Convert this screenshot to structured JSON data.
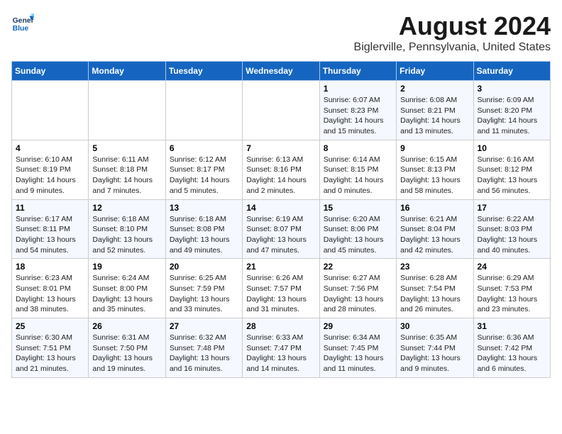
{
  "header": {
    "logo_line1": "General",
    "logo_line2": "Blue",
    "main_title": "August 2024",
    "subtitle": "Biglerville, Pennsylvania, United States"
  },
  "weekdays": [
    "Sunday",
    "Monday",
    "Tuesday",
    "Wednesday",
    "Thursday",
    "Friday",
    "Saturday"
  ],
  "weeks": [
    [
      {
        "day": "",
        "info": ""
      },
      {
        "day": "",
        "info": ""
      },
      {
        "day": "",
        "info": ""
      },
      {
        "day": "",
        "info": ""
      },
      {
        "day": "1",
        "info": "Sunrise: 6:07 AM\nSunset: 8:23 PM\nDaylight: 14 hours and 15 minutes."
      },
      {
        "day": "2",
        "info": "Sunrise: 6:08 AM\nSunset: 8:21 PM\nDaylight: 14 hours and 13 minutes."
      },
      {
        "day": "3",
        "info": "Sunrise: 6:09 AM\nSunset: 8:20 PM\nDaylight: 14 hours and 11 minutes."
      }
    ],
    [
      {
        "day": "4",
        "info": "Sunrise: 6:10 AM\nSunset: 8:19 PM\nDaylight: 14 hours and 9 minutes."
      },
      {
        "day": "5",
        "info": "Sunrise: 6:11 AM\nSunset: 8:18 PM\nDaylight: 14 hours and 7 minutes."
      },
      {
        "day": "6",
        "info": "Sunrise: 6:12 AM\nSunset: 8:17 PM\nDaylight: 14 hours and 5 minutes."
      },
      {
        "day": "7",
        "info": "Sunrise: 6:13 AM\nSunset: 8:16 PM\nDaylight: 14 hours and 2 minutes."
      },
      {
        "day": "8",
        "info": "Sunrise: 6:14 AM\nSunset: 8:15 PM\nDaylight: 14 hours and 0 minutes."
      },
      {
        "day": "9",
        "info": "Sunrise: 6:15 AM\nSunset: 8:13 PM\nDaylight: 13 hours and 58 minutes."
      },
      {
        "day": "10",
        "info": "Sunrise: 6:16 AM\nSunset: 8:12 PM\nDaylight: 13 hours and 56 minutes."
      }
    ],
    [
      {
        "day": "11",
        "info": "Sunrise: 6:17 AM\nSunset: 8:11 PM\nDaylight: 13 hours and 54 minutes."
      },
      {
        "day": "12",
        "info": "Sunrise: 6:18 AM\nSunset: 8:10 PM\nDaylight: 13 hours and 52 minutes."
      },
      {
        "day": "13",
        "info": "Sunrise: 6:18 AM\nSunset: 8:08 PM\nDaylight: 13 hours and 49 minutes."
      },
      {
        "day": "14",
        "info": "Sunrise: 6:19 AM\nSunset: 8:07 PM\nDaylight: 13 hours and 47 minutes."
      },
      {
        "day": "15",
        "info": "Sunrise: 6:20 AM\nSunset: 8:06 PM\nDaylight: 13 hours and 45 minutes."
      },
      {
        "day": "16",
        "info": "Sunrise: 6:21 AM\nSunset: 8:04 PM\nDaylight: 13 hours and 42 minutes."
      },
      {
        "day": "17",
        "info": "Sunrise: 6:22 AM\nSunset: 8:03 PM\nDaylight: 13 hours and 40 minutes."
      }
    ],
    [
      {
        "day": "18",
        "info": "Sunrise: 6:23 AM\nSunset: 8:01 PM\nDaylight: 13 hours and 38 minutes."
      },
      {
        "day": "19",
        "info": "Sunrise: 6:24 AM\nSunset: 8:00 PM\nDaylight: 13 hours and 35 minutes."
      },
      {
        "day": "20",
        "info": "Sunrise: 6:25 AM\nSunset: 7:59 PM\nDaylight: 13 hours and 33 minutes."
      },
      {
        "day": "21",
        "info": "Sunrise: 6:26 AM\nSunset: 7:57 PM\nDaylight: 13 hours and 31 minutes."
      },
      {
        "day": "22",
        "info": "Sunrise: 6:27 AM\nSunset: 7:56 PM\nDaylight: 13 hours and 28 minutes."
      },
      {
        "day": "23",
        "info": "Sunrise: 6:28 AM\nSunset: 7:54 PM\nDaylight: 13 hours and 26 minutes."
      },
      {
        "day": "24",
        "info": "Sunrise: 6:29 AM\nSunset: 7:53 PM\nDaylight: 13 hours and 23 minutes."
      }
    ],
    [
      {
        "day": "25",
        "info": "Sunrise: 6:30 AM\nSunset: 7:51 PM\nDaylight: 13 hours and 21 minutes."
      },
      {
        "day": "26",
        "info": "Sunrise: 6:31 AM\nSunset: 7:50 PM\nDaylight: 13 hours and 19 minutes."
      },
      {
        "day": "27",
        "info": "Sunrise: 6:32 AM\nSunset: 7:48 PM\nDaylight: 13 hours and 16 minutes."
      },
      {
        "day": "28",
        "info": "Sunrise: 6:33 AM\nSunset: 7:47 PM\nDaylight: 13 hours and 14 minutes."
      },
      {
        "day": "29",
        "info": "Sunrise: 6:34 AM\nSunset: 7:45 PM\nDaylight: 13 hours and 11 minutes."
      },
      {
        "day": "30",
        "info": "Sunrise: 6:35 AM\nSunset: 7:44 PM\nDaylight: 13 hours and 9 minutes."
      },
      {
        "day": "31",
        "info": "Sunrise: 6:36 AM\nSunset: 7:42 PM\nDaylight: 13 hours and 6 minutes."
      }
    ]
  ],
  "colors": {
    "header_bg": "#1565c0",
    "header_text": "#ffffff",
    "odd_row_bg": "#f5f8ff",
    "even_row_bg": "#ffffff"
  }
}
